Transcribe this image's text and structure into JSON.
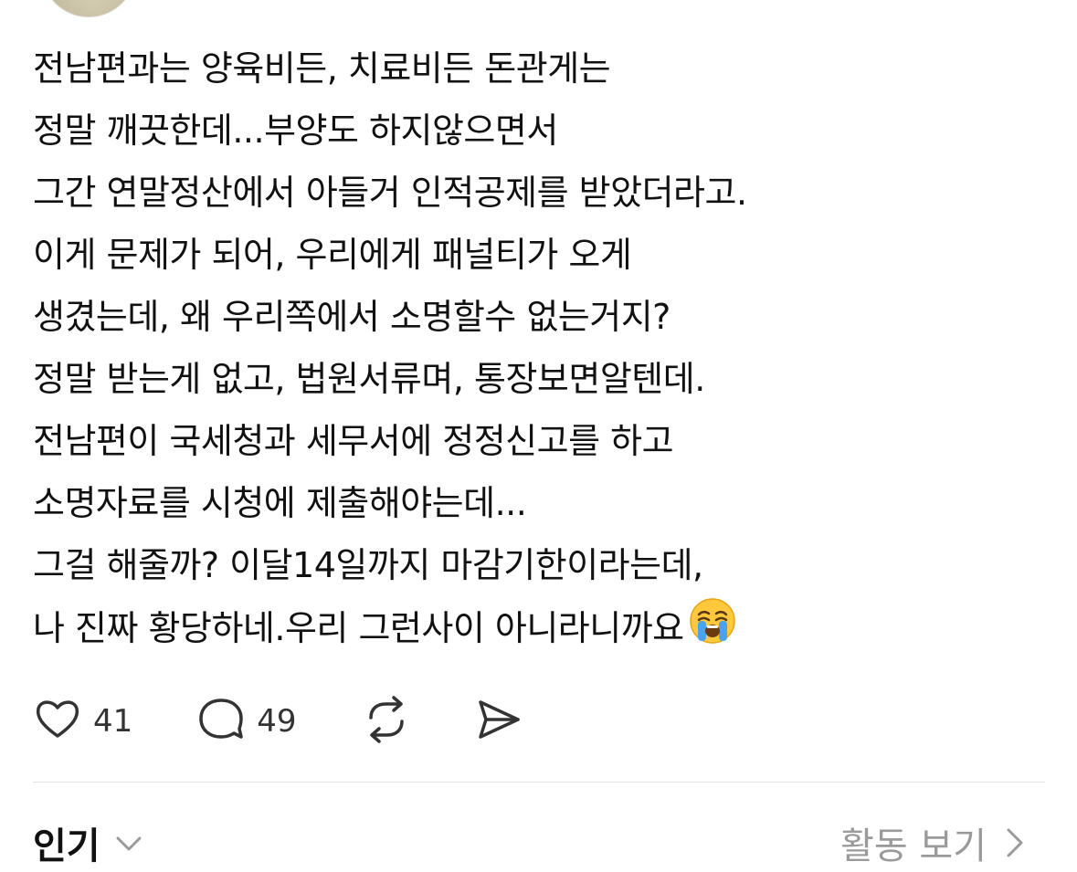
{
  "post": {
    "lines": [
      "전남편과는 양육비든, 치료비든 돈관게는",
      "정말 깨끗한데...부양도 하지않으면서",
      "그간 연말정산에서 아들거 인적공제를 받았더라고.",
      "이게 문제가 되어, 우리에게 패널티가 오게",
      "생겼는데, 왜 우리쪽에서 소명할수 없는거지?",
      "정말 받는게 없고, 법원서류며, 통장보면알텐데.",
      "전남편이 국세청과 세무서에 정정신고를 하고",
      "소명자료를 시청에 제출해야는데...",
      "그걸 해줄까? 이달14일까지 마감기한이라는데,",
      "나 진짜 황당하네.우리 그런사이 아니라니까요"
    ],
    "emoji": "loudly-crying-face"
  },
  "actions": {
    "like": {
      "icon": "heart-icon",
      "count": "41"
    },
    "reply": {
      "icon": "comment-bubble-icon",
      "count": "49"
    },
    "repost": {
      "icon": "repost-icon"
    },
    "share": {
      "icon": "send-icon"
    }
  },
  "sort": {
    "label": "인기",
    "icon": "chevron-down-icon"
  },
  "activity": {
    "label": "활동 보기",
    "icon": "chevron-right-icon"
  },
  "colors": {
    "text": "#111111",
    "muted": "#9a9a9a",
    "divider": "#e4e4e4",
    "icon": "#333333",
    "emoji_face": "#FFC83D",
    "emoji_tears": "#4AA3F0"
  }
}
